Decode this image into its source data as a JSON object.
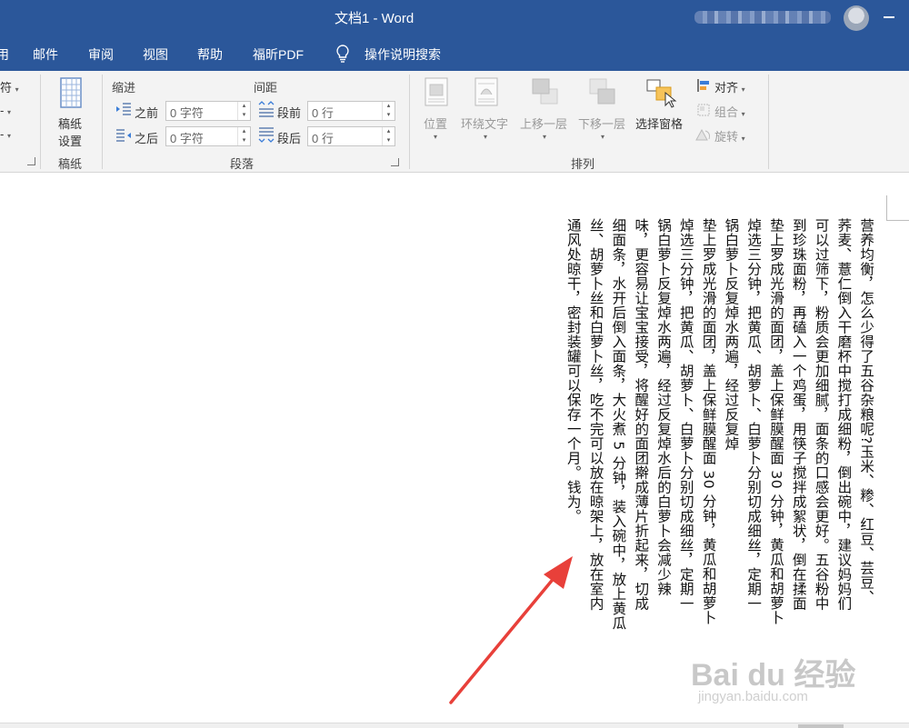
{
  "titlebar": {
    "title": "文档1  -  Word",
    "account_name": ""
  },
  "menu": {
    "tabs": [
      "用",
      "邮件",
      "审阅",
      "视图",
      "帮助",
      "福昕PDF"
    ],
    "search": "操作说明搜索"
  },
  "ribbon": {
    "left_partial": {
      "item1": "符",
      "item2": "-",
      "item3": "-"
    },
    "gaozhi": {
      "button": [
        "稿纸",
        "设置"
      ],
      "group": "稿纸"
    },
    "paragraph": {
      "indent_title": "缩进",
      "spacing_title": "间距",
      "before_label": "之前",
      "after_label": "之后",
      "space_before_label": "段前",
      "space_after_label": "段后",
      "indent_before": "0 字符",
      "indent_after": "0 字符",
      "space_before": "0 行",
      "space_after": "0 行",
      "group": "段落"
    },
    "arrange": {
      "position": "位置",
      "wrap_text": "环绕文字",
      "bring_forward": "上移一层",
      "send_backward": "下移一层",
      "selection_pane": "选择窗格",
      "align": "对齐",
      "group_obj": "组合",
      "rotate": "旋转",
      "group": "排列"
    }
  },
  "document": {
    "columns": [
      "营养均衡，怎么少得了五谷杂粮呢?玉米、糁、红豆、芸豆、",
      "荞麦、薏仁倒入干磨杯中搅打成细粉，倒出碗中，建议妈妈们",
      "可以过筛下，粉质会更加细腻，面条的口感会更好。五谷粉中",
      "到珍珠面粉，再磕入一个鸡蛋，用筷子搅拌成絮状，倒在揉面",
      "垫上罗成光滑的面团，盖上保鲜膜醒面 30 分钟，黄瓜和胡萝卜",
      "焯选三分钟，把黄瓜、胡萝卜、白萝卜分别切成细丝，定期一",
      "锅白萝卜反复焯水两遍，经过反复焯",
      "垫上罗成光滑的面团，盖上保鲜膜醒面 30 分钟，黄瓜和胡萝卜",
      "焯选三分钟，把黄瓜、胡萝卜、白萝卜分别切成细丝，定期一",
      "锅白萝卜反复焯水两遍，经过反复焯水后的白萝卜会减少辣",
      "味，更容易让宝宝接受，将醒好的面团擀成薄片折起来，切成",
      "细面条，水开后倒入面条，大火煮 5 分钟，装入碗中，放上黄瓜",
      "丝、胡萝卜丝和白萝卜丝，吃不完可以放在晾架上，放在室内",
      "通风处晾干，密封装罐可以保存一个月。钱为。"
    ]
  },
  "watermark": {
    "brand": "Bai du 经验",
    "url": "jingyan.baidu.com"
  },
  "colors": {
    "titlebar": "#2b579a",
    "ribbon": "#f3f3f3",
    "arrow": "#e8403a"
  }
}
